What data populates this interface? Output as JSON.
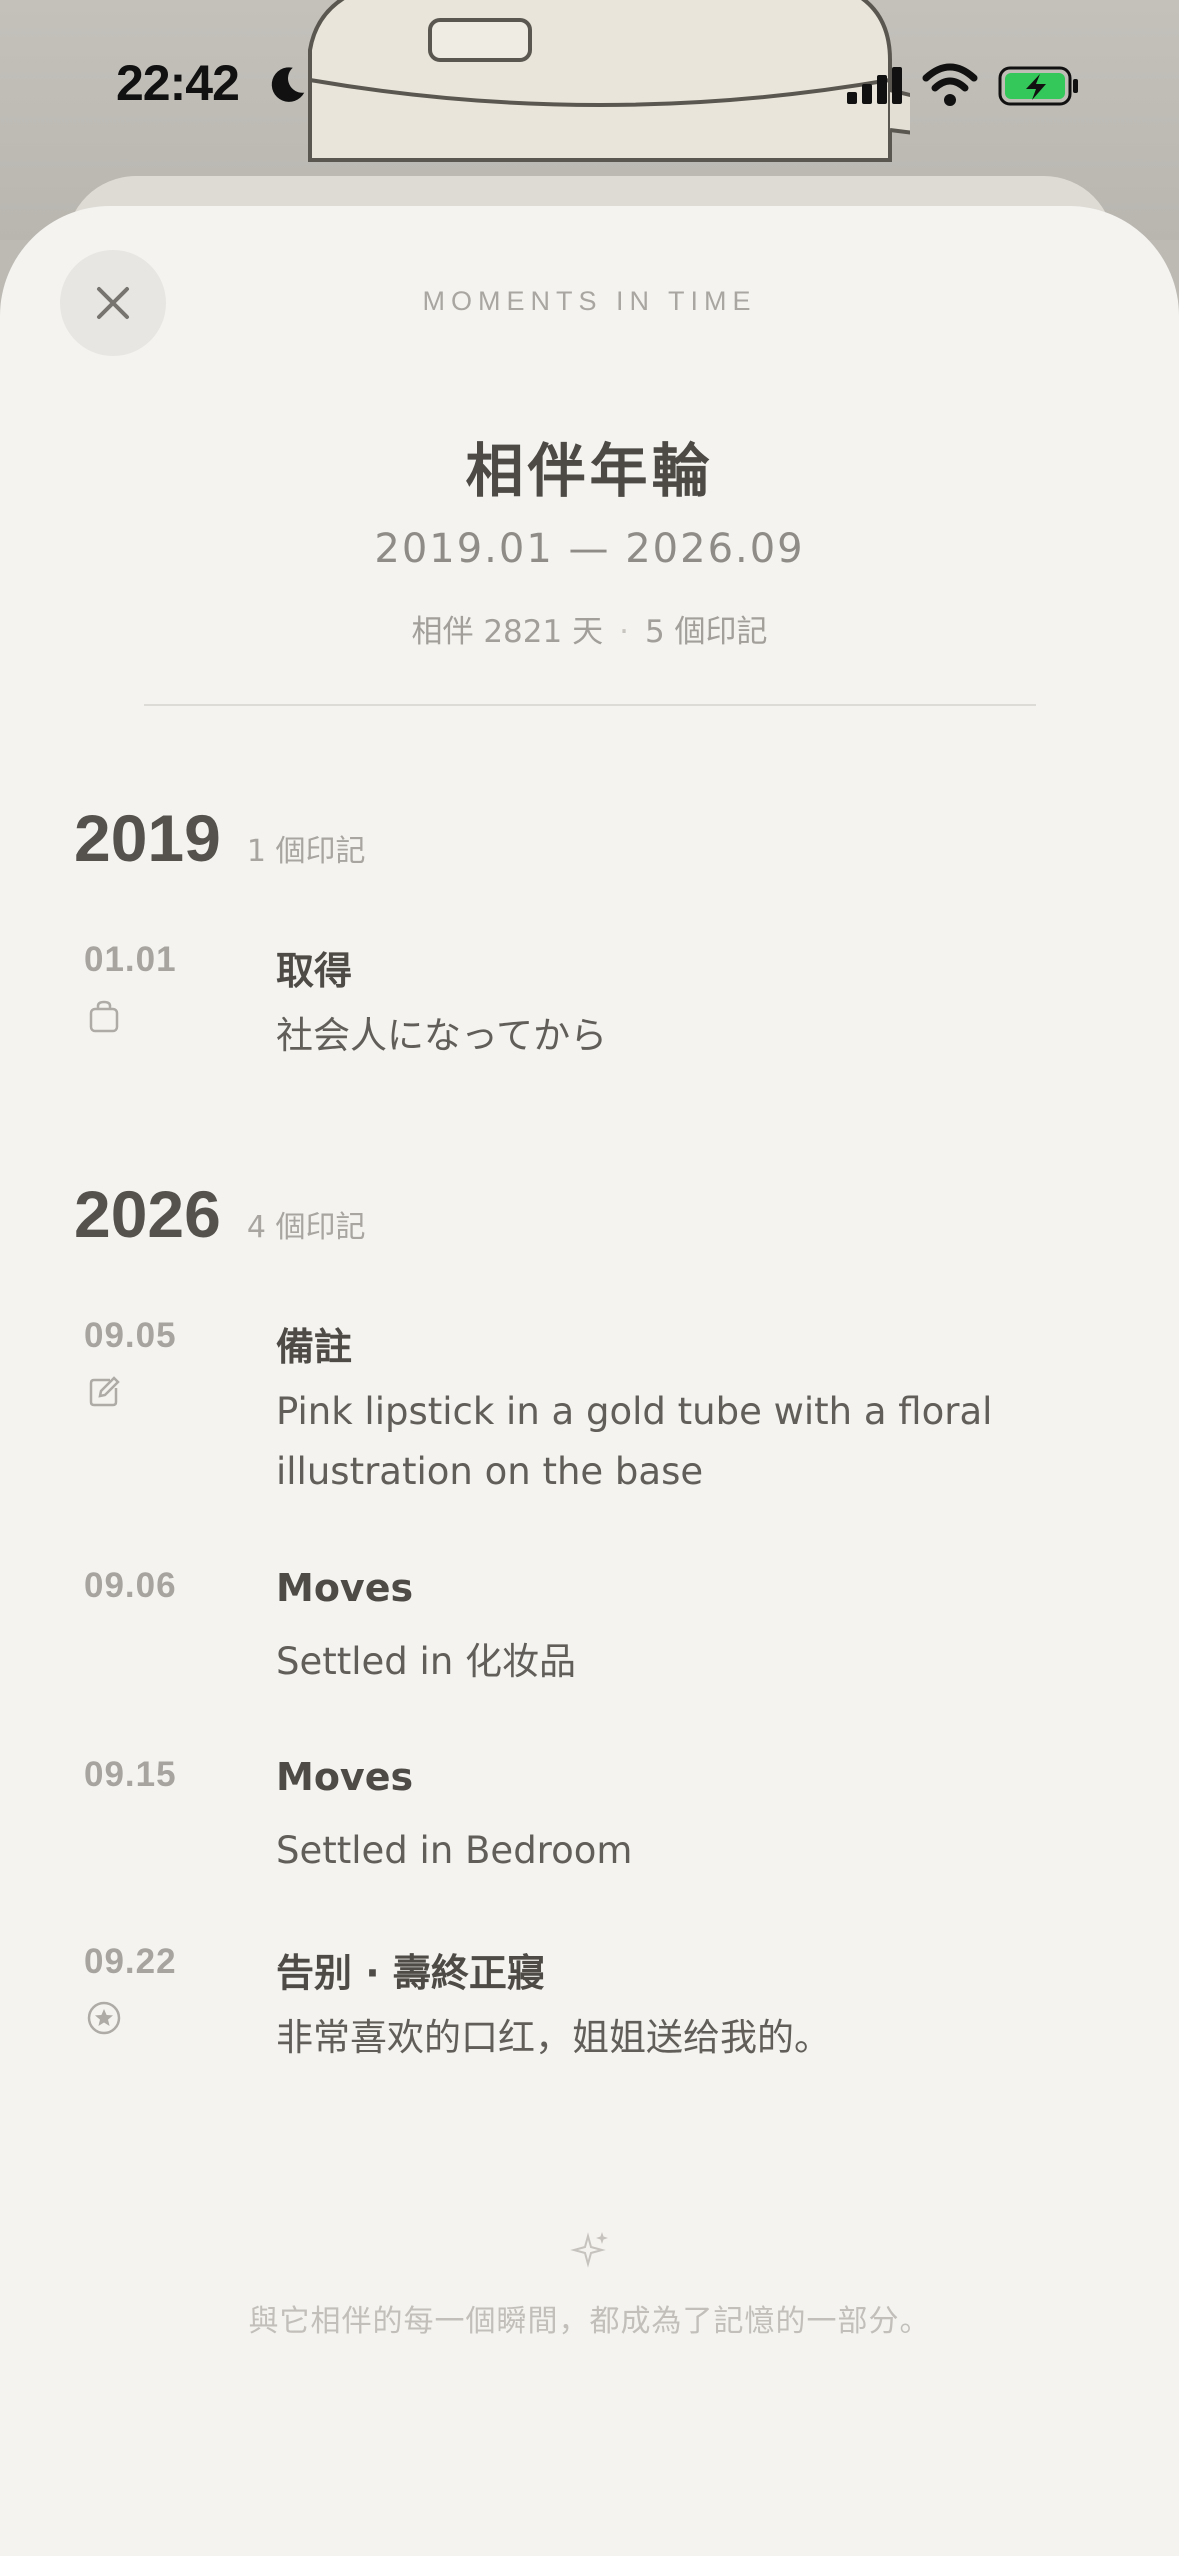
{
  "status_bar": {
    "time": "22:42",
    "icons": [
      "moon-icon",
      "signal-icon",
      "wifi-icon",
      "battery-charging-icon"
    ],
    "battery_color": "#34c759"
  },
  "sheet": {
    "eyebrow": "MOMENTS IN TIME",
    "title": "相伴年輪",
    "range": "2019.01 — 2026.09",
    "stats": {
      "days": "相伴 2821 天",
      "separator": "·",
      "count": "5 個印記"
    }
  },
  "years": [
    {
      "year": "2019",
      "count": "1 個印記",
      "entries": [
        {
          "date": "01.01",
          "icon": "bag-icon",
          "title": "取得",
          "description": "社会人になってから"
        }
      ]
    },
    {
      "year": "2026",
      "count": "4 個印記",
      "entries": [
        {
          "date": "09.05",
          "icon": "note-edit-icon",
          "title": "備註",
          "description": "Pink lipstick in a gold tube with a floral illustration on the base"
        },
        {
          "date": "09.06",
          "icon": "",
          "title": "Moves",
          "description": "Settled in 化妆品"
        },
        {
          "date": "09.15",
          "icon": "",
          "title": "Moves",
          "description": "Settled in Bedroom"
        },
        {
          "date": "09.22",
          "icon": "star-badge-icon",
          "title": "告别 · 壽終正寢",
          "description": "非常喜欢的口红，姐姐送给我的。"
        }
      ]
    }
  ],
  "footer": {
    "icon": "sparkle-icon",
    "text": "與它相伴的每一個瞬間，都成為了記憶的一部分。"
  },
  "colors": {
    "sheet_bg": "#f4f3ef",
    "text_primary": "#4e4b47",
    "text_muted": "#a7a49f"
  }
}
